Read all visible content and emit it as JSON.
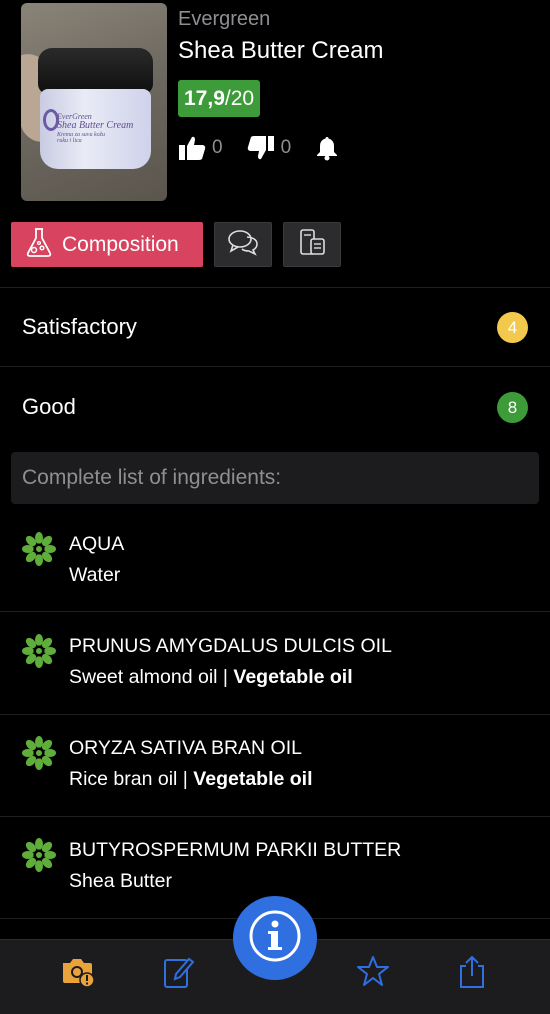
{
  "product": {
    "brand": "Evergreen",
    "name": "Shea Butter Cream",
    "score_value": "17,9",
    "score_max": "/20",
    "likes": "0",
    "dislikes": "0",
    "photo_label_lines": [
      "EverGreen",
      "Shea Butter Cream",
      "Krema za suvu kožu",
      "ruku i lica"
    ]
  },
  "tabs": {
    "composition_label": "Composition",
    "composition_icon": "flask-icon",
    "reviews_icon": "chat-bubbles-icon",
    "compare_icon": "compare-products-icon",
    "accent": "#d8445f"
  },
  "ratings": [
    {
      "label": "Satisfactory",
      "count": "4",
      "color": "#f2c94c"
    },
    {
      "label": "Good",
      "count": "8",
      "color": "#3d9b39"
    }
  ],
  "ingredients_header": "Complete list of ingredients:",
  "ingredients": [
    {
      "inci": "AQUA",
      "common": "Water",
      "category": "",
      "icon": "flower-icon"
    },
    {
      "inci": "PRUNUS AMYGDALUS DULCIS OIL",
      "common": "Sweet almond oil",
      "category": "Vegetable oil",
      "icon": "flower-icon"
    },
    {
      "inci": "ORYZA SATIVA BRAN OIL",
      "common": "Rice bran oil",
      "category": "Vegetable oil",
      "icon": "flower-icon"
    },
    {
      "inci": "BUTYROSPERMUM PARKII BUTTER",
      "common": "Shea Butter",
      "category": "",
      "icon": "flower-icon"
    }
  ],
  "tabbar": {
    "items": [
      "camera-alert-icon",
      "edit-icon",
      "info-icon",
      "star-icon",
      "share-icon"
    ],
    "colors": {
      "camera": "#e8a33c",
      "nav": "#2f6fe0"
    }
  }
}
